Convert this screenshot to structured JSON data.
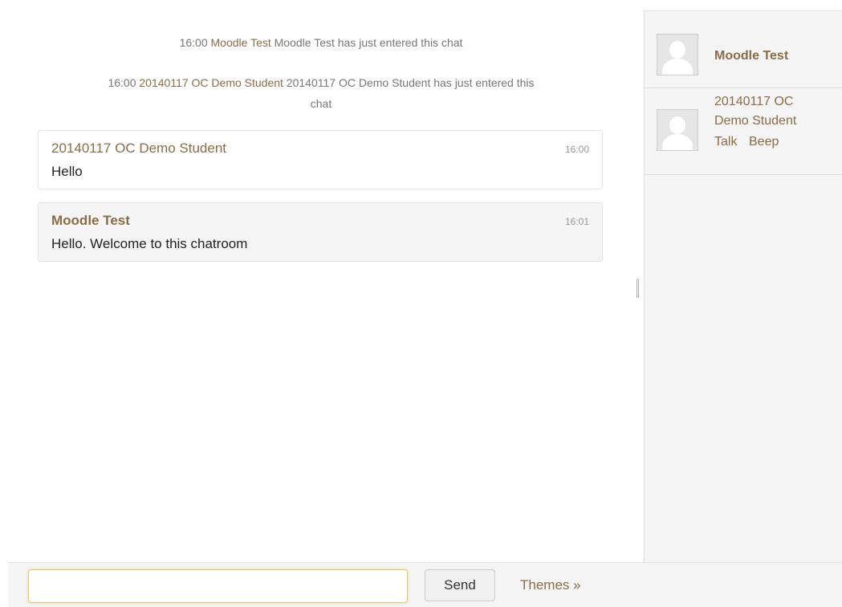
{
  "system_messages": [
    {
      "time": "16:00",
      "user": "Moodle Test",
      "text": "Moodle Test has just entered this chat"
    },
    {
      "time": "16:00",
      "user": "20140117 OC Demo Student",
      "text_line1": "20140117 OC Demo Student has just entered this",
      "text_line2": "chat"
    }
  ],
  "messages": [
    {
      "user": "20140117 OC Demo Student",
      "time": "16:00",
      "text": "Hello"
    },
    {
      "user": "Moodle Test",
      "time": "16:01",
      "text": "Hello. Welcome to this chatroom"
    }
  ],
  "users": [
    {
      "name": "Moodle Test"
    },
    {
      "name_line1": "20140117 OC",
      "name_line2": "Demo Student",
      "talk_label": "Talk",
      "beep_label": "Beep"
    }
  ],
  "input": {
    "value": "",
    "placeholder": ""
  },
  "send_label": "Send",
  "themes_label": "Themes »",
  "colors": {
    "link": "#8a6d46",
    "panel_bg": "#f5f5f5",
    "input_focus": "#e8c66b"
  }
}
